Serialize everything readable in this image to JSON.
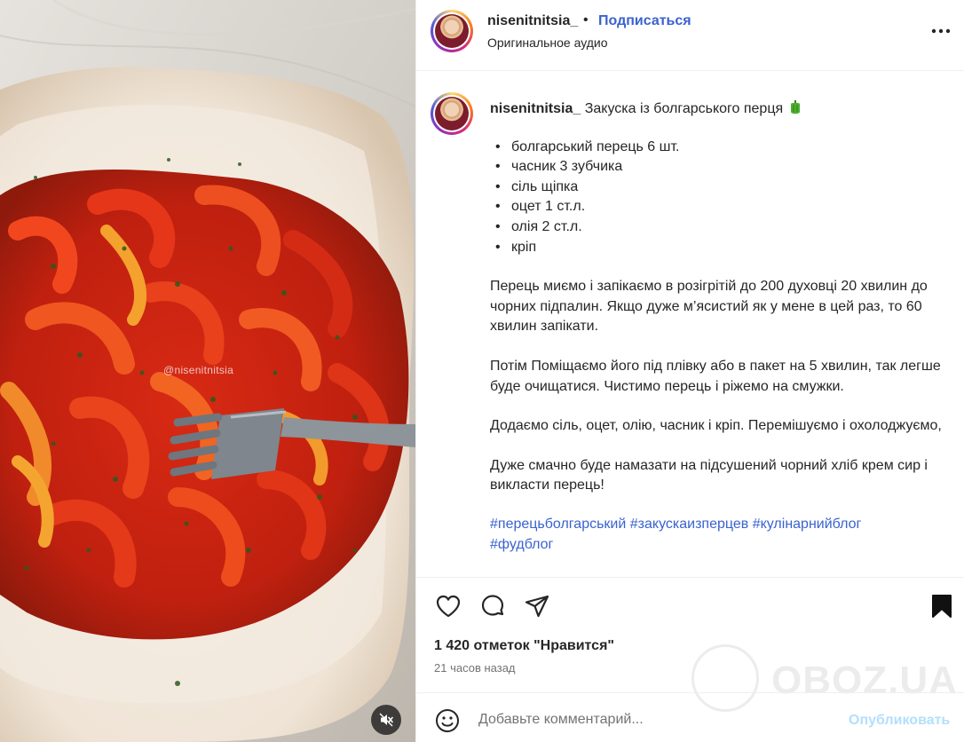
{
  "post": {
    "username": "nisenitnitsia_",
    "separator": "•",
    "follow_label": "Подписаться",
    "audio_label": "Оригинальное аудио"
  },
  "media": {
    "watermark_handle": "@nisenitnitsia",
    "mute_icon": "speaker-muted-icon"
  },
  "caption": {
    "username": "nisenitnitsia_",
    "title": "Закуска із болгарського перця",
    "title_emoji": "green-pepper-icon",
    "ingredients": [
      "болгарський перець 6 шт.",
      "часник 3 зубчика",
      "сіль щіпка",
      "оцет 1 ст.л.",
      "олія 2 ст.л.",
      "кріп"
    ],
    "paragraphs": [
      "Перець миємо і запікаємо в розігрітій до 200 духовці 20 хвилин до чорних підпалин. Якщо дуже м’ясистий як у мене в цей раз, то 60 хвилин запікати.",
      "Потім Поміщаємо його під плівку або в пакет на 5 хвилин, так легше буде очищатися. Чистимо перець і ріжемо на смужки.",
      "Додаємо сіль, оцет, олію, часник і кріп. Перемішуємо і охолоджуємо,",
      "Дуже смачно буде намазати на підсушений чорний хліб крем сир і викласти перець!"
    ],
    "hashtags": [
      "#перецьболгарський",
      "#закускаизперцев",
      "#кулінарнийблог",
      "#фудблог"
    ]
  },
  "actions": {
    "like_icon": "heart-icon",
    "comment_icon": "comment-icon",
    "share_icon": "send-icon",
    "save_icon": "bookmark-icon",
    "likes_text": "1 420 отметок \"Нравится\"",
    "time_text": "21 часов назад"
  },
  "comment_box": {
    "placeholder": "Добавьте комментарий...",
    "publish_label": "Опубликовать"
  },
  "watermark": {
    "text": "OBOZ.UA"
  },
  "colors": {
    "link_blue": "#3a62d0",
    "publish_disabled": "#b2dffc",
    "muted_text": "#737373",
    "pepper_red": "#e0291b"
  }
}
